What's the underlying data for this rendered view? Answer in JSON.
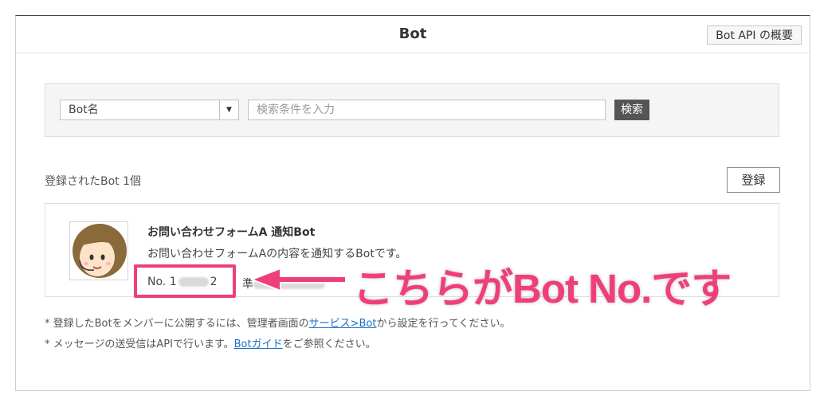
{
  "header": {
    "title": "Bot",
    "api_button": "Bot API の概要"
  },
  "search": {
    "select_value": "Bot名",
    "input_placeholder": "検索条件を入力",
    "button_label": "検索"
  },
  "list": {
    "count_label": "登録されたBot 1個",
    "register_button": "登録"
  },
  "bot": {
    "name": "お問い合わせフォームA 通知Bot",
    "description": "お問い合わせフォームAの内容を通知するBotです。",
    "number_prefix": "No. 1",
    "number_suffix": "2",
    "status_prefix": "準"
  },
  "annotation": {
    "text": "こちらがBot No.です",
    "color": "#ef3f7a"
  },
  "notes": {
    "line1_before": "* 登録したBotをメンバーに公開するには、管理者画面の",
    "line1_link": "サービス>Bot",
    "line1_after": "から設定を行ってください。",
    "line2_before": "* メッセージの送受信はAPIで行います。",
    "line2_link": "Botガイド",
    "line2_after": "をご参照ください。"
  }
}
